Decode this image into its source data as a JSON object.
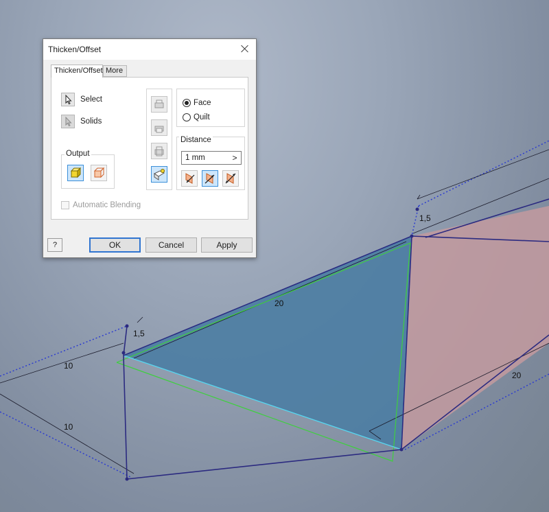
{
  "dialog": {
    "title": "Thicken/Offset",
    "tabs": [
      {
        "label": "Thicken/Offset",
        "active": true
      },
      {
        "label": "More",
        "active": false
      }
    ],
    "select_label": "Select",
    "solids_label": "Solids",
    "output_label": "Output",
    "mode_options": [
      {
        "label": "Face",
        "selected": true
      },
      {
        "label": "Quilt",
        "selected": false
      }
    ],
    "distance_label": "Distance",
    "distance_value": "1 mm",
    "distance_arrow": ">",
    "auto_blending_label": "Automatic Blending",
    "auto_blending_checked": false,
    "buttons": {
      "ok": "OK",
      "cancel": "Cancel",
      "apply": "Apply"
    },
    "help_glyph": "?"
  },
  "viewport": {
    "dimensions": [
      "20",
      "20",
      "10",
      "10",
      "1,5",
      "1,5"
    ],
    "colors": {
      "blue_face": "#4d7ea3",
      "pink_face": "#c39a9f",
      "edge": "#2b2a80",
      "dashed": "#2c3cd0",
      "green_edge": "#3fcf3f",
      "cyan_edge": "#57d7f0"
    }
  }
}
